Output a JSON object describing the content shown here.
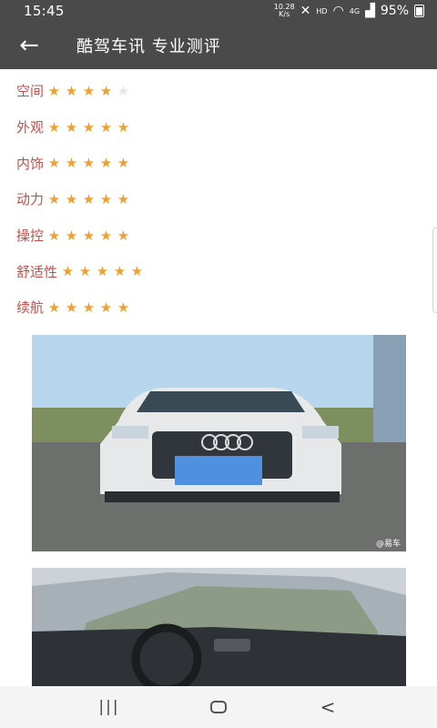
{
  "status_bar": {
    "time": "15:45",
    "net_speed_value": "10.28",
    "net_speed_unit": "K/s",
    "hd_label": "HD",
    "network_type": "4G",
    "battery_percent": "95%"
  },
  "app_bar": {
    "title": "酷驾车讯 专业测评"
  },
  "ratings": [
    {
      "label": "空间",
      "stars": 4,
      "max": 5
    },
    {
      "label": "外观",
      "stars": 5,
      "max": 5
    },
    {
      "label": "内饰",
      "stars": 5,
      "max": 5
    },
    {
      "label": "动力",
      "stars": 5,
      "max": 5
    },
    {
      "label": "操控",
      "stars": 5,
      "max": 5
    },
    {
      "label": "舒适性",
      "stars": 5,
      "max": 5
    },
    {
      "label": "续航",
      "stars": 5,
      "max": 5
    }
  ],
  "photos": {
    "watermark": "@易车"
  },
  "colors": {
    "header_bg": "#4a4a4a",
    "label_red": "#c0504d",
    "star_on": "#f0a030",
    "star_off": "#e6e6e6"
  },
  "icons": {
    "back": "arrow-left-icon",
    "nav_recent": "recent-apps-icon",
    "nav_home": "home-icon",
    "nav_back": "chevron-left-icon"
  }
}
